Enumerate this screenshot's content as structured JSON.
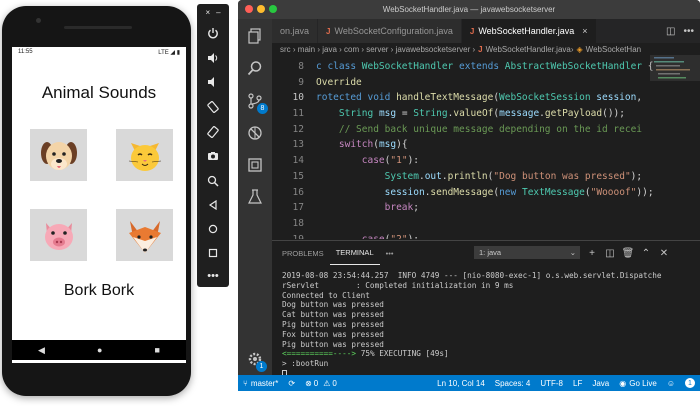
{
  "phone": {
    "status_time": "11:55",
    "status_right": "LTE ◢ ▮",
    "app_title": "Animal Sounds",
    "result_text": "Bork Bork",
    "animals": [
      "dog",
      "cat",
      "pig",
      "fox"
    ]
  },
  "emulator_toolbar": {
    "close": "×",
    "minimize": "–"
  },
  "vscode": {
    "window_title": "WebSocketHandler.java — javawebsocketserver",
    "tabs": [
      {
        "label": "on.java",
        "icon": "J"
      },
      {
        "label": "WebSocketConfiguration.java",
        "icon": "J"
      },
      {
        "label": "WebSocketHandler.java",
        "icon": "J",
        "close": "×"
      }
    ],
    "breadcrumb": "src › main › java › com › server › javawebsocketserver › ",
    "breadcrumb_file": "WebSocketHandler.java",
    "breadcrumb_tail": " › ",
    "breadcrumb_class": "WebSocketHan",
    "scm_badge": "8",
    "settings_badge": "1",
    "line_numbers": [
      "8",
      "9",
      "10",
      "11",
      "12",
      "13",
      "14",
      "15",
      "16",
      "17",
      "18",
      "19"
    ],
    "current_line": "10",
    "panel": {
      "tabs": [
        "PROBLEMS",
        "TERMINAL",
        "•••"
      ],
      "terminal_select": "1: java",
      "lines": [
        "2019-08-08 23:54:44.257  INFO 4749 --- [nio-8080-exec-1] o.s.web.servlet.Dispatche",
        "rServlet        : Completed initialization in 9 ms",
        "Connected to Client",
        "Dog button was pressed",
        "Cat button was pressed",
        "Pig button was pressed",
        "Fox button was pressed",
        "Pig button was pressed"
      ],
      "progress_bar": "<==========---->",
      "progress_text": " 75% EXECUTING [49s]",
      "prompt": "> :bootRun"
    },
    "status": {
      "branch": "master*",
      "sync": "⟳",
      "errors": "0",
      "warnings": "0",
      "position": "Ln 10, Col 14",
      "spaces": "Spaces: 4",
      "encoding": "UTF-8",
      "eol": "LF",
      "language": "Java",
      "golive": "Go Live",
      "notifications": "1"
    }
  }
}
